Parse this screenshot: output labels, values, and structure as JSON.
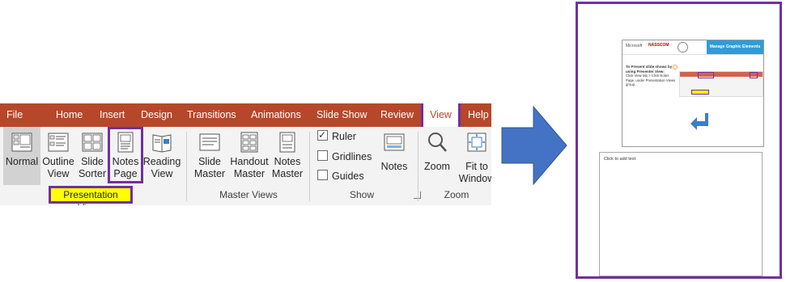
{
  "ribbon": {
    "tabs": [
      {
        "label": "File"
      },
      {
        "label": "Home"
      },
      {
        "label": "Insert"
      },
      {
        "label": "Design"
      },
      {
        "label": "Transitions"
      },
      {
        "label": "Animations"
      },
      {
        "label": "Slide Show"
      },
      {
        "label": "Review"
      },
      {
        "label": "View"
      },
      {
        "label": "Help"
      }
    ],
    "active_tab": "View",
    "groups": {
      "presentation_views": {
        "name": "Presentation Views",
        "buttons": [
          {
            "label": "Normal",
            "icon": "normal-view-icon"
          },
          {
            "label": "Outline\nView",
            "icon": "outline-view-icon"
          },
          {
            "label": "Slide\nSorter",
            "icon": "slide-sorter-icon"
          },
          {
            "label": "Notes\nPage",
            "icon": "notes-page-icon"
          },
          {
            "label": "Reading\nView",
            "icon": "reading-view-icon"
          }
        ]
      },
      "master_views": {
        "name": "Master Views",
        "buttons": [
          {
            "label": "Slide\nMaster",
            "icon": "slide-master-icon"
          },
          {
            "label": "Handout\nMaster",
            "icon": "handout-master-icon"
          },
          {
            "label": "Notes\nMaster",
            "icon": "notes-master-icon"
          }
        ]
      },
      "show": {
        "name": "Show",
        "checkboxes": [
          {
            "label": "Ruler",
            "checked": true
          },
          {
            "label": "Gridlines",
            "checked": false
          },
          {
            "label": "Guides",
            "checked": false
          }
        ],
        "notes_button": {
          "label": "Notes",
          "icon": "notes-icon"
        }
      },
      "zoom": {
        "name": "Zoom",
        "buttons": [
          {
            "label": "Zoom",
            "icon": "magnifier-icon"
          },
          {
            "label": "Fit to\nWindow",
            "icon": "fit-to-window-icon"
          }
        ]
      }
    },
    "colors": {
      "tab_bar": "#b7472a",
      "highlight": "#7030a0",
      "group_highlight": "#ffff00"
    }
  },
  "arrow": {
    "icon": "right-arrow-icon",
    "color": "#4472c4"
  },
  "notes_page": {
    "slide": {
      "header_left": "Microsoft",
      "header_middle": "NASSCOM",
      "header_right": "Manage Graphic Elements",
      "heading": "To Present slide shows by using Presenter View:",
      "bullet": "Click View tab > Click Notes Page, under Presentation Views group.",
      "icon": "return-arrow-icon"
    },
    "notes_placeholder": "Click to add text"
  }
}
